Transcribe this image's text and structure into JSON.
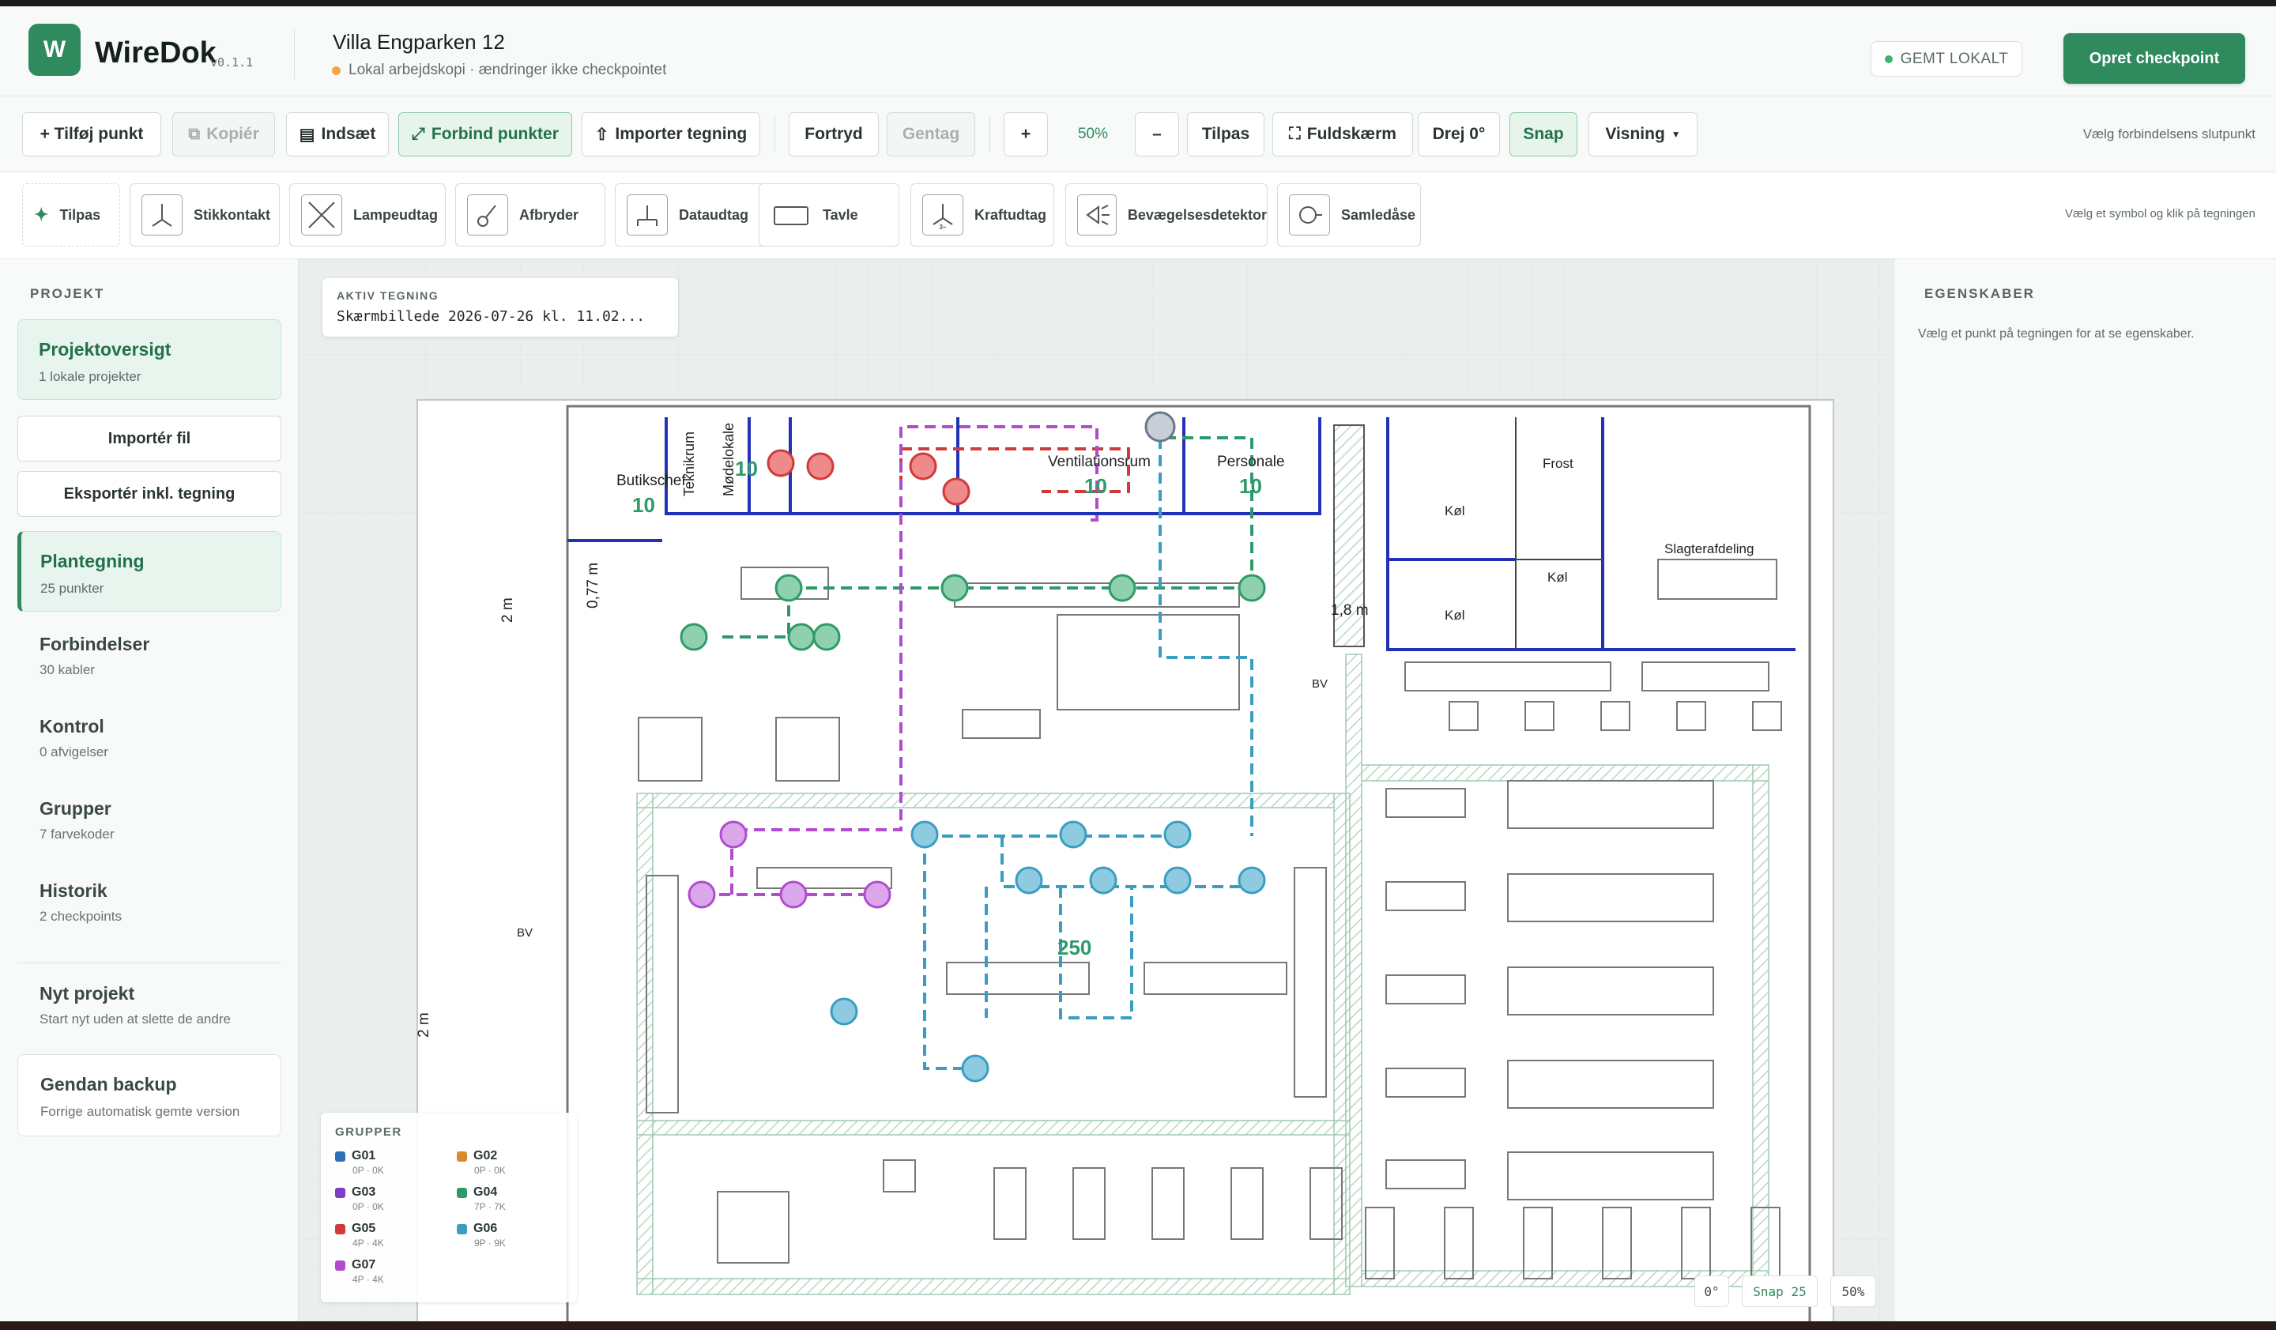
{
  "app": {
    "name": "WireDok",
    "version": "v0.1.1",
    "logo_letter": "W"
  },
  "project": {
    "title": "Villa Engparken 12",
    "subtitle": "Lokal arbejdskopi · ændringer ikke checkpointet"
  },
  "header": {
    "saved_badge": "GEMT LOKALT",
    "checkpoint_button": "Opret checkpoint"
  },
  "toolbar": {
    "add_point": "+ Tilføj punkt",
    "copy": "Kopiér",
    "paste": "Indsæt",
    "connect": "Forbind punkter",
    "import_drawing": "Importer tegning",
    "undo": "Fortryd",
    "redo": "Gentag",
    "zoom_in": "+",
    "zoom_level": "50%",
    "zoom_out": "–",
    "fit": "Tilpas",
    "fullscreen": "Fuldskærm",
    "rotate": "Drej 0°",
    "snap": "Snap",
    "view": "Visning",
    "hint": "Vælg forbindelsens slutpunkt"
  },
  "symbols": {
    "items": [
      {
        "label": "Tilpas",
        "icon": "sparkle-icon"
      },
      {
        "label": "Stikkontakt",
        "icon": "socket-icon"
      },
      {
        "label": "Lampeudtag",
        "icon": "lamp-icon"
      },
      {
        "label": "Afbryder",
        "icon": "switch-icon"
      },
      {
        "label": "Dataudtag",
        "icon": "data-outlet-icon"
      },
      {
        "label": "Tavle",
        "icon": "panel-icon"
      },
      {
        "label": "Kraftudtag",
        "icon": "power-outlet-icon"
      },
      {
        "label": "Bevægelsesdetektor",
        "icon": "motion-detector-icon"
      },
      {
        "label": "Samledåse",
        "icon": "junction-box-icon"
      }
    ],
    "hint": "Vælg et symbol og klik på tegningen"
  },
  "sidebar": {
    "section": "PROJEKT",
    "overview": {
      "title": "Projektoversigt",
      "sub": "1 lokale projekter"
    },
    "import_file": "Importér fil",
    "export": "Eksportér inkl. tegning",
    "nav": [
      {
        "title": "Plantegning",
        "sub": "25 punkter"
      },
      {
        "title": "Forbindelser",
        "sub": "30 kabler"
      },
      {
        "title": "Kontrol",
        "sub": "0 afvigelser"
      },
      {
        "title": "Grupper",
        "sub": "7 farvekoder"
      },
      {
        "title": "Historik",
        "sub": "2 checkpoints"
      }
    ],
    "new_project": {
      "title": "Nyt projekt",
      "sub": "Start nyt uden at slette de andre"
    },
    "restore": {
      "title": "Gendan backup",
      "sub": "Forrige automatisk gemte version"
    }
  },
  "canvas": {
    "active_label": "AKTIV TEGNING",
    "active_file": "Skærmbillede 2026-07-26 kl. 11.02...",
    "rooms": [
      "Butikschef",
      "Teknikrum",
      "Mødelokale",
      "Ventilationsrum",
      "Personale",
      "Frost",
      "Køl",
      "Køl",
      "Køl",
      "Slagterafdeling"
    ],
    "room_numbers": [
      "10",
      "10",
      "10",
      "10",
      "250"
    ],
    "dims": [
      "2 m",
      "0,77 m",
      "1,8 m",
      "2 m"
    ],
    "bv": "BV",
    "legend_title": "GRUPPER",
    "groups": [
      {
        "id": "G01",
        "sub": "0P · 0K",
        "color": "#2f6fb5"
      },
      {
        "id": "G02",
        "sub": "0P · 0K",
        "color": "#d98a2b"
      },
      {
        "id": "G03",
        "sub": "0P · 0K",
        "color": "#7a3fc4"
      },
      {
        "id": "G04",
        "sub": "7P · 7K",
        "color": "#2e9a6a"
      },
      {
        "id": "G05",
        "sub": "4P · 4K",
        "color": "#d03a3a"
      },
      {
        "id": "G06",
        "sub": "9P · 9K",
        "color": "#3a9ec2"
      },
      {
        "id": "G07",
        "sub": "4P · 4K",
        "color": "#b24ccf"
      }
    ],
    "status_rotate": "0°",
    "status_snap": "Snap 25",
    "status_zoom": "50%"
  },
  "properties": {
    "title": "EGENSKABER",
    "empty": "Vælg et punkt på tegningen for at se egenskaber."
  }
}
